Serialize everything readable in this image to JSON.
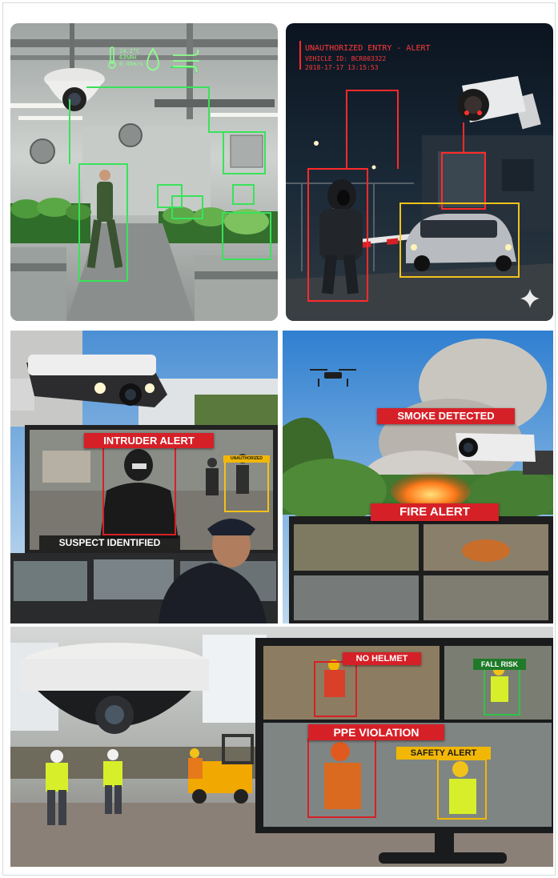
{
  "panel1": {
    "sensor": {
      "temp": "24.2°C",
      "humidity": "63%RH",
      "wind": "0.45m/s"
    },
    "colors": {
      "box": "#39e25a",
      "bg": "#d5d8d4"
    }
  },
  "panel2": {
    "hud_title": "UNAUTHORIZED ENTRY - ALERT",
    "hud_vehicle": "VEHICLE ID: BCR003322",
    "hud_time": "2018-17-17 13:15:53",
    "colors": {
      "person_box": "#ff2a2a",
      "vehicle_box": "#f2c21a"
    }
  },
  "panel3": {
    "intruder_label": "INTRUDER ALERT",
    "suspect_label": "SUSPECT IDENTIFIED",
    "small_label": "UNAUTHORIZED"
  },
  "panel4": {
    "smoke_label": "SMOKE DETECTED",
    "fire_label": "FIRE ALERT"
  },
  "panel5": {
    "no_helmet_label": "NO HELMET",
    "fall_risk_label": "FALL RISK",
    "ppe_label": "PPE VIOLATION",
    "safety_label": "SAFETY ALERT"
  },
  "icons": [
    "camera-icon",
    "thermometer-icon",
    "water-drop-icon",
    "wind-icon",
    "drone-icon",
    "sparkle-icon"
  ]
}
